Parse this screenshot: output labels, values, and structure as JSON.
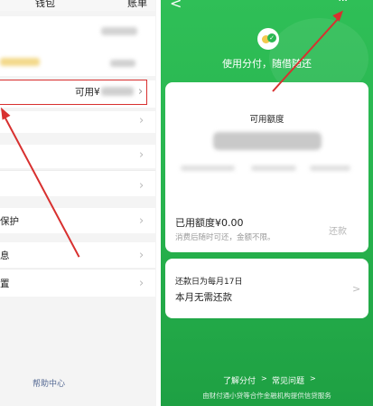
{
  "left_panel": {
    "header": {
      "title": "钱包",
      "right_link": "账单"
    },
    "available_row": {
      "label": "可用¥"
    },
    "rows": [
      {
        "label": "保护"
      },
      {
        "label": "息"
      },
      {
        "label": "置"
      }
    ],
    "footer_link": "帮助中心"
  },
  "right_panel": {
    "top_bar": {
      "back": "<",
      "more": "···"
    },
    "tagline": "使用分付，随借随还",
    "quota_card": {
      "label": "可用额度",
      "used_label": "已用额度¥0.00",
      "hint": "消费后随时可还，金额不限。",
      "repay_button": "还款"
    },
    "repay_card": {
      "due_label": "还款日为每月17日",
      "status": "本月无需还款",
      "chevron": ">"
    },
    "links": {
      "learn": "了解分付",
      "learn_arrow": ">",
      "faq": "常见问题",
      "faq_arrow": ">"
    },
    "footer_note": "由财付通小贷等合作金融机构提供信贷服务"
  },
  "colors": {
    "accent_green": "#2bb752",
    "annotation_red": "#d8302f",
    "logo_yellow": "#f2c94c"
  },
  "icons": [
    "chevron-right-icon",
    "back-arrow-icon",
    "more-icon",
    "fenfu-logo-icon"
  ]
}
